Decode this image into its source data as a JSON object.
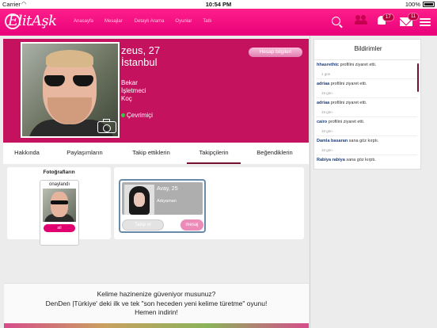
{
  "status_bar": {
    "carrier": "Carrier",
    "time": "10:54 PM",
    "battery": "100%"
  },
  "header": {
    "logo": "ElitAşk",
    "nav": [
      "Anasayfa",
      "Mesajlar",
      "Detaylı Arama",
      "Oyunlar",
      "Tatlı"
    ],
    "notification_count": "17",
    "message_count": "11",
    "accent": "#ec0b7f"
  },
  "profile": {
    "name_age": "zeus, 27",
    "city": "İstanbul",
    "status": "Bekar",
    "job": "İşletmeci",
    "sign": "Koç",
    "online": "Çevrimiçi",
    "account_button": "Hesap bilgileri",
    "bg_color": "#c4125e"
  },
  "tabs": [
    {
      "label": "Hakkında"
    },
    {
      "label": "Paylaşımların"
    },
    {
      "label": "Takip ettiklerin"
    },
    {
      "label": "Takipçilerin",
      "active": true
    },
    {
      "label": "Beğendiklerin"
    }
  ],
  "photos": {
    "title": "Fotoğrafların",
    "approved": "onaylandı",
    "delete": "sil"
  },
  "follower": {
    "name_age": "Avay, 25",
    "city": "Adıyaman",
    "follow_button": "Takip et",
    "message_button": "mesaj"
  },
  "notifications": {
    "title": "Bildirimler",
    "items": [
      {
        "user": "hhasrethtc",
        "action": "profilini ziyaret etti.",
        "when": "1 gün"
      },
      {
        "user": "adriaa",
        "action": "profilini ziyaret etti.",
        "when": "15 gün"
      },
      {
        "user": "adriaa",
        "action": "profilini ziyaret etti.",
        "when": "15 gün"
      },
      {
        "user": "cairo",
        "action": "profilini ziyaret etti.",
        "when": "16 gün"
      },
      {
        "user": "Damla basaran",
        "action": "sana göz kırptı.",
        "when": "16 gün"
      },
      {
        "user": "Rabiya rabiya",
        "action": "sana göz kırptı.",
        "when": ""
      }
    ]
  },
  "ad": {
    "line1": "Kelime hazinenize güveniyor musunuz?",
    "line2": "DenDen |Türkiye' deki ilk ve tek \"son heceden yeni kelime türetme\" oyunu!",
    "line3": "Hemen indirin!"
  }
}
